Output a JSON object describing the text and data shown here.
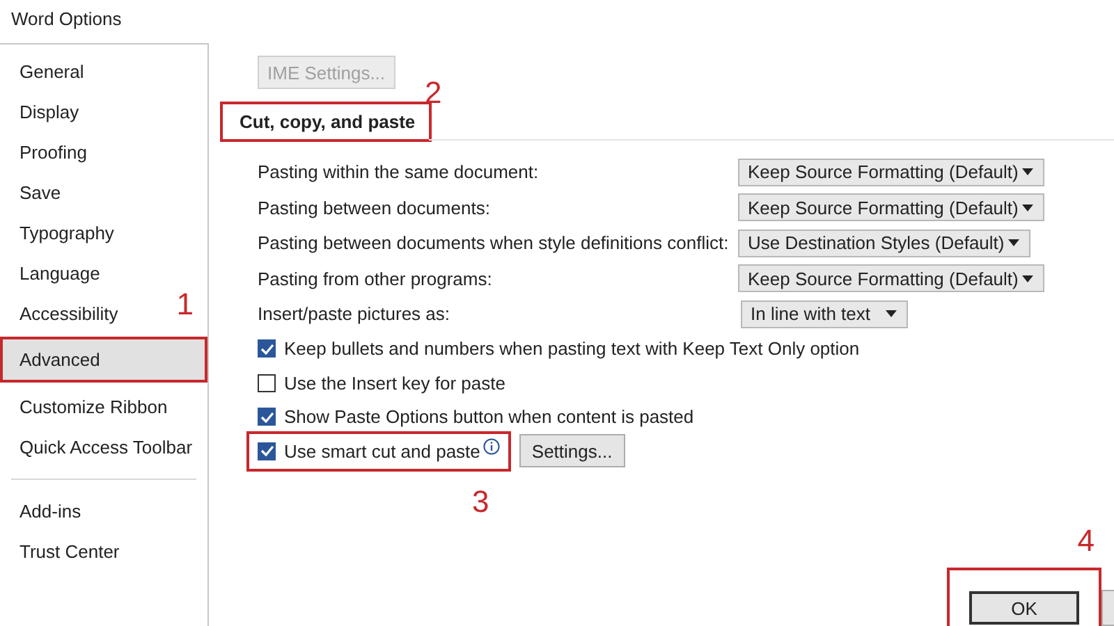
{
  "window": {
    "title": "Word Options"
  },
  "sidebar": {
    "groups": [
      [
        {
          "label": "General",
          "selected": false,
          "highlighted": false
        },
        {
          "label": "Display",
          "selected": false,
          "highlighted": false
        },
        {
          "label": "Proofing",
          "selected": false,
          "highlighted": false
        },
        {
          "label": "Save",
          "selected": false,
          "highlighted": false
        },
        {
          "label": "Typography",
          "selected": false,
          "highlighted": false
        },
        {
          "label": "Language",
          "selected": false,
          "highlighted": false
        },
        {
          "label": "Accessibility",
          "selected": false,
          "highlighted": false
        },
        {
          "label": "Advanced",
          "selected": true,
          "highlighted": true,
          "callout": "1"
        },
        {
          "label": "Customize Ribbon",
          "selected": false,
          "highlighted": false
        },
        {
          "label": "Quick Access Toolbar",
          "selected": false,
          "highlighted": false
        }
      ],
      [
        {
          "label": "Add-ins",
          "selected": false,
          "highlighted": false
        },
        {
          "label": "Trust Center",
          "selected": false,
          "highlighted": false
        }
      ]
    ]
  },
  "ime_button": {
    "label": "IME Settings...",
    "disabled": true
  },
  "section": {
    "title": "Cut, copy, and paste",
    "highlighted": true,
    "callout": "2"
  },
  "dropdown_rows": [
    {
      "label": "Pasting within the same document:",
      "value": "Keep Source Formatting (Default)"
    },
    {
      "label": "Pasting between documents:",
      "value": "Keep Source Formatting (Default)"
    },
    {
      "label": "Pasting between documents when style definitions conflict:",
      "value": "Use Destination Styles (Default)"
    },
    {
      "label": "Pasting from other programs:",
      "value": "Keep Source Formatting (Default)"
    },
    {
      "label": "Insert/paste pictures as:",
      "value": "In line with text"
    }
  ],
  "checkboxes": [
    {
      "label": "Keep bullets and numbers when pasting text with Keep Text Only option",
      "checked": true,
      "highlighted": false
    },
    {
      "label": "Use the Insert key for paste",
      "checked": false,
      "highlighted": false
    },
    {
      "label": "Show Paste Options button when content is pasted",
      "checked": true,
      "highlighted": false
    },
    {
      "label": "Use smart cut and paste",
      "checked": true,
      "highlighted": true,
      "info": true,
      "button": "Settings...",
      "callout": "3"
    }
  ],
  "footer": {
    "ok": "OK",
    "highlighted": true,
    "callout": "4"
  }
}
